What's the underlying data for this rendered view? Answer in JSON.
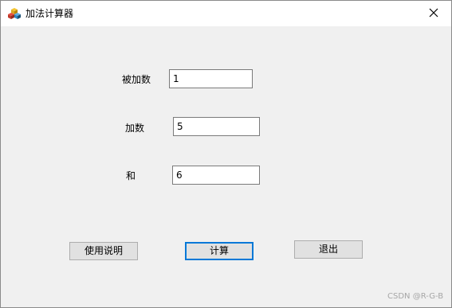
{
  "window": {
    "title": "加法计算器",
    "app_icon": "colored-blocks-icon",
    "close_icon": "close-icon"
  },
  "form": {
    "addend1_label": "被加数",
    "addend1_value": "1",
    "addend2_label": "加数",
    "addend2_value": "5",
    "sum_label": "和",
    "sum_value": "6"
  },
  "buttons": {
    "help_label": "使用说明",
    "calc_label": "计算",
    "exit_label": "退出"
  },
  "watermark": "CSDN @R-G-B",
  "colors": {
    "focus_border": "#0078d7",
    "background": "#f0f0f0"
  }
}
